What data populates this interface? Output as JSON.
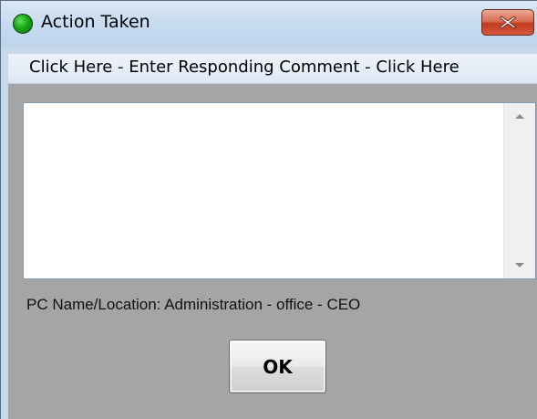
{
  "window": {
    "title": "Action Taken",
    "icon": "green-circle-icon",
    "close_icon": "close-x-icon",
    "close_button_color": "#c43a1f"
  },
  "menu": {
    "items": [
      {
        "label": "Click Here - Enter Responding Comment - Click Here"
      }
    ]
  },
  "comment": {
    "value": "",
    "placeholder": ""
  },
  "info": {
    "pc_name_location": "PC Name/Location: Administration - office - CEO"
  },
  "buttons": {
    "ok_label": "OK"
  },
  "colors": {
    "client_background": "#a5a5a5",
    "titlebar": "#c9dcf0"
  }
}
